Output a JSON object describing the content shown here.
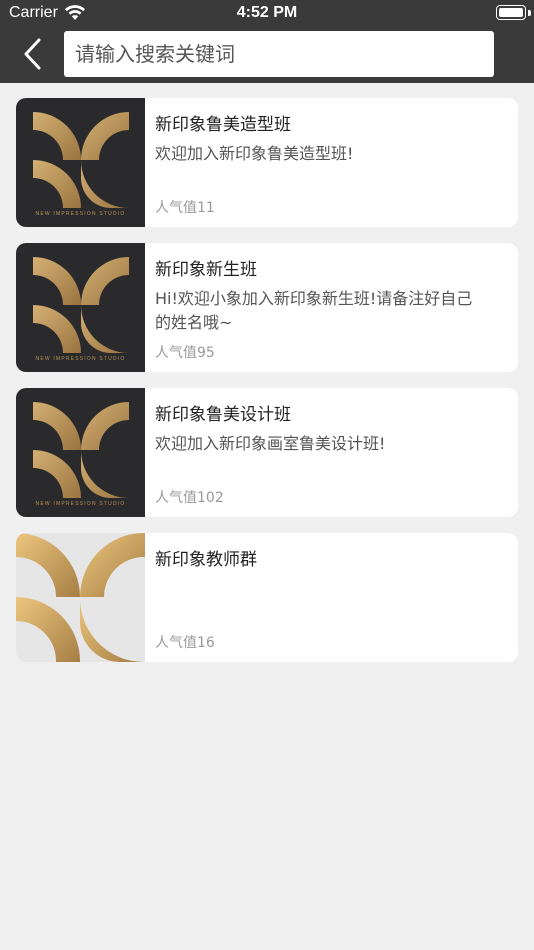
{
  "status_bar": {
    "carrier": "Carrier",
    "time": "4:52 PM"
  },
  "search": {
    "placeholder": "请输入搜索关键词"
  },
  "groups": [
    {
      "title": "新印象鲁美造型班",
      "description": "欢迎加入新印象鲁美造型班!",
      "popularity": "人气值11",
      "thumb_style": "dark",
      "thumb_text": "NEW IMPRESSION STUDIO"
    },
    {
      "title": "新印象新生班",
      "description": "Hi!欢迎小象加入新印象新生班!请备注好自己的姓名哦~",
      "popularity": "人气值95",
      "thumb_style": "dark",
      "thumb_text": "NEW IMPRESSION STUDIO"
    },
    {
      "title": "新印象鲁美设计班",
      "description": "欢迎加入新印象画室鲁美设计班!",
      "popularity": "人气值102",
      "thumb_style": "dark",
      "thumb_text": "NEW IMPRESSION STUDIO"
    },
    {
      "title": "新印象教师群",
      "description": "",
      "popularity": "人气值16",
      "thumb_style": "light",
      "thumb_text": ""
    }
  ],
  "colors": {
    "header_bg": "#3a3a3a",
    "page_bg": "#f0f0f0",
    "gold": "#c09a5e"
  }
}
